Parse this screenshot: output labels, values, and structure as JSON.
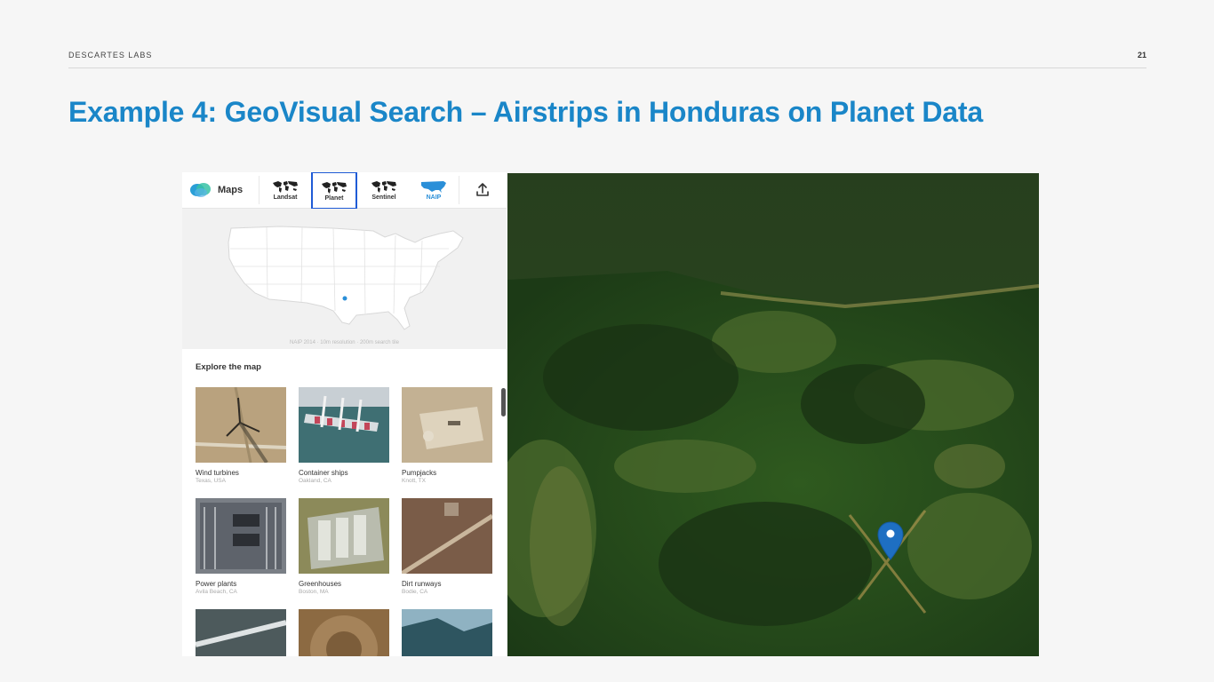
{
  "slide": {
    "company": "DESCARTES LABS",
    "page_number": "21",
    "title": "Example 4:  GeoVisual Search – Airstrips in Honduras on Planet Data"
  },
  "app": {
    "brand": "Maps",
    "layers": [
      {
        "label": "Landsat",
        "selected": false
      },
      {
        "label": "Planet",
        "selected": true
      },
      {
        "label": "Sentinel",
        "selected": false
      },
      {
        "label": "NAIP",
        "selected": false
      }
    ],
    "share_icon": "upload-icon",
    "selection_color": "#1f5bd6",
    "accent_color": "#1a86c8"
  },
  "overview_map": {
    "caption": "NAIP 2014 · 10m resolution · 200m search tile"
  },
  "explore": {
    "title": "Explore the map",
    "items": [
      {
        "name": "Wind turbines",
        "location": "Texas, USA"
      },
      {
        "name": "Container ships",
        "location": "Oakland, CA"
      },
      {
        "name": "Pumpjacks",
        "location": "Knott, TX"
      },
      {
        "name": "Power plants",
        "location": "Avila Beach, CA"
      },
      {
        "name": "Greenhouses",
        "location": "Boston, MA"
      },
      {
        "name": "Dirt runways",
        "location": "Bodie, CA"
      },
      {
        "name": "",
        "location": ""
      },
      {
        "name": "",
        "location": ""
      },
      {
        "name": "",
        "location": ""
      }
    ]
  },
  "satellite_view": {
    "marker_icon": "location-pin-icon",
    "marker_color": "#1e6fc2"
  }
}
